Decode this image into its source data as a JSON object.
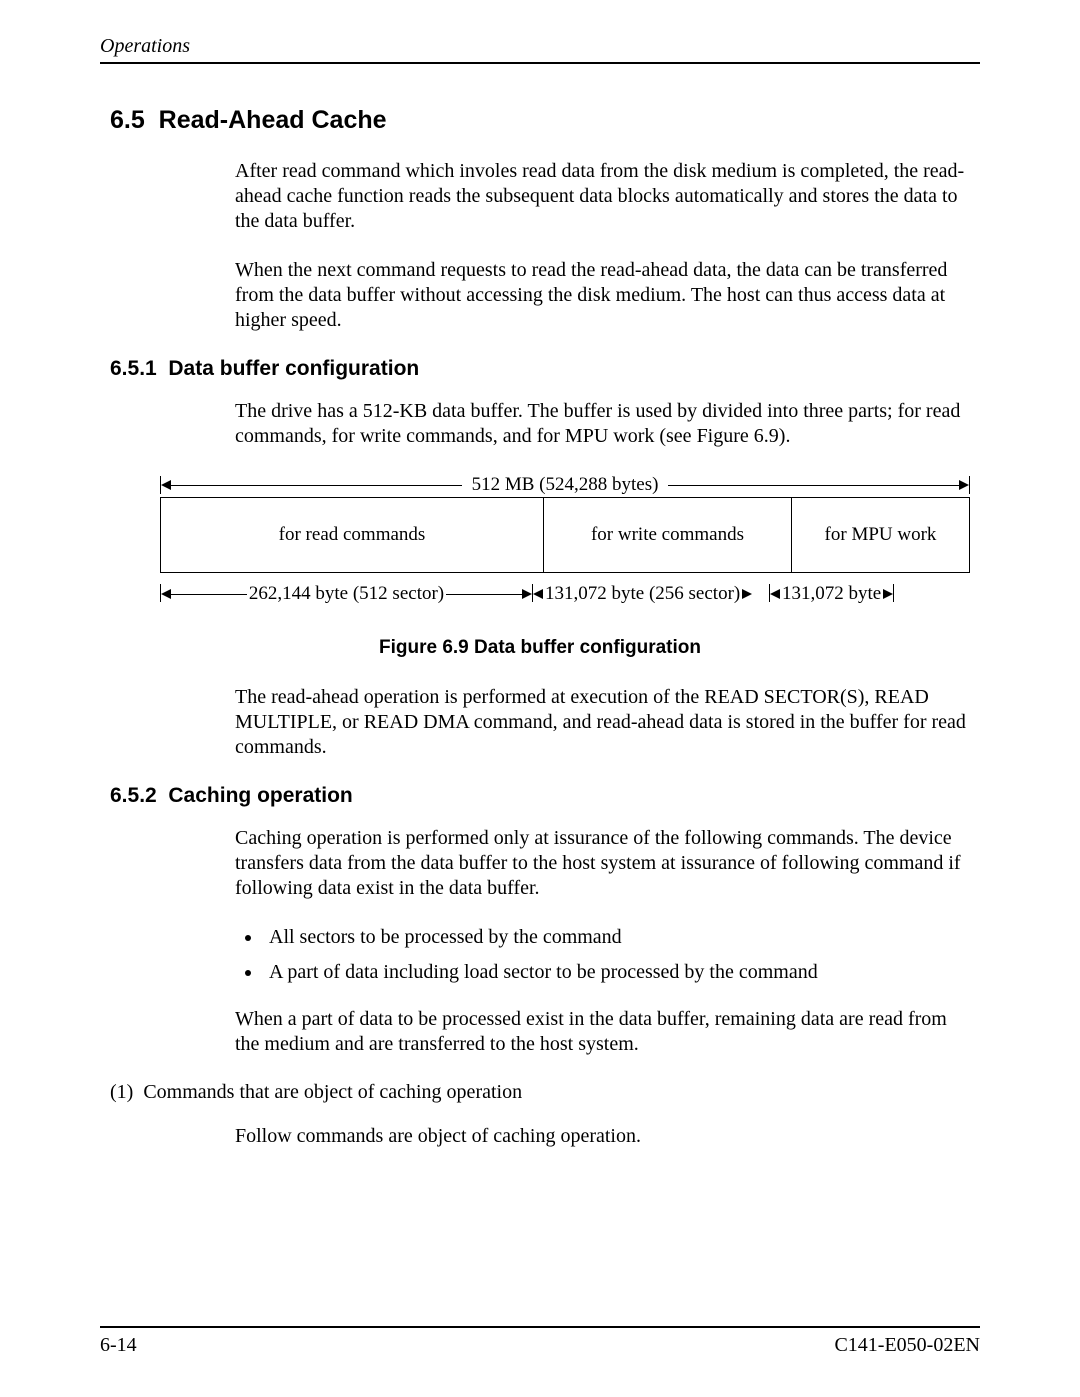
{
  "header": {
    "running": "Operations"
  },
  "section": {
    "num": "6.5",
    "title": "Read-Ahead Cache",
    "p1": "After read command which involes read data from the disk medium is completed, the read-ahead cache function reads the subsequent data blocks automatically and stores the data to the data buffer.",
    "p2": "When the next command requests to read the read-ahead data, the data can be transferred from the data buffer without accessing the disk medium.  The host can thus access data at higher speed."
  },
  "sub1": {
    "num": "6.5.1",
    "title": "Data buffer configuration",
    "p1": "The drive has a 512-KB data buffer.  The buffer is used by divided into three parts; for read commands, for write commands, and for MPU work (see Figure 6.9).",
    "p2": "The read-ahead operation is performed at execution of the READ SECTOR(S), READ MULTIPLE, or READ DMA command, and read-ahead data is stored in the buffer for read commands."
  },
  "diagram": {
    "total": "512 MB (524,288 bytes)",
    "box1": "for read commands",
    "box2": "for write commands",
    "box3": "for MPU work",
    "dim1": "262,144 byte (512 sector)",
    "dim2": "131,072 byte (256 sector)",
    "dim3": "131,072 byte",
    "caption": "Figure 6.9 Data buffer configuration"
  },
  "sub2": {
    "num": "6.5.2",
    "title": "Caching operation",
    "p1": "Caching operation is performed only at issurance of the following commands.  The device transfers data from the data buffer to the host system at issurance of following command if following data exist in the data buffer.",
    "li1": "All sectors to be processed by the command",
    "li2": "A part of data including load sector to be processed by the command",
    "p2": "When a part of data to be processed exist in the data buffer, remaining data are read from the medium and are transferred to the host system.",
    "item1_num": "(1)",
    "item1": "Commands that are object of caching operation",
    "p3": "Follow commands are object of caching operation."
  },
  "footer": {
    "page": "6-14",
    "doc": "C141-E050-02EN"
  },
  "chart_data": {
    "type": "table",
    "title": "Data buffer configuration",
    "total_label": "512 MB (524,288 bytes)",
    "segments": [
      {
        "label": "for read commands",
        "size_bytes": 262144,
        "sectors": 512
      },
      {
        "label": "for write commands",
        "size_bytes": 131072,
        "sectors": 256
      },
      {
        "label": "for MPU work",
        "size_bytes": 131072
      }
    ]
  }
}
